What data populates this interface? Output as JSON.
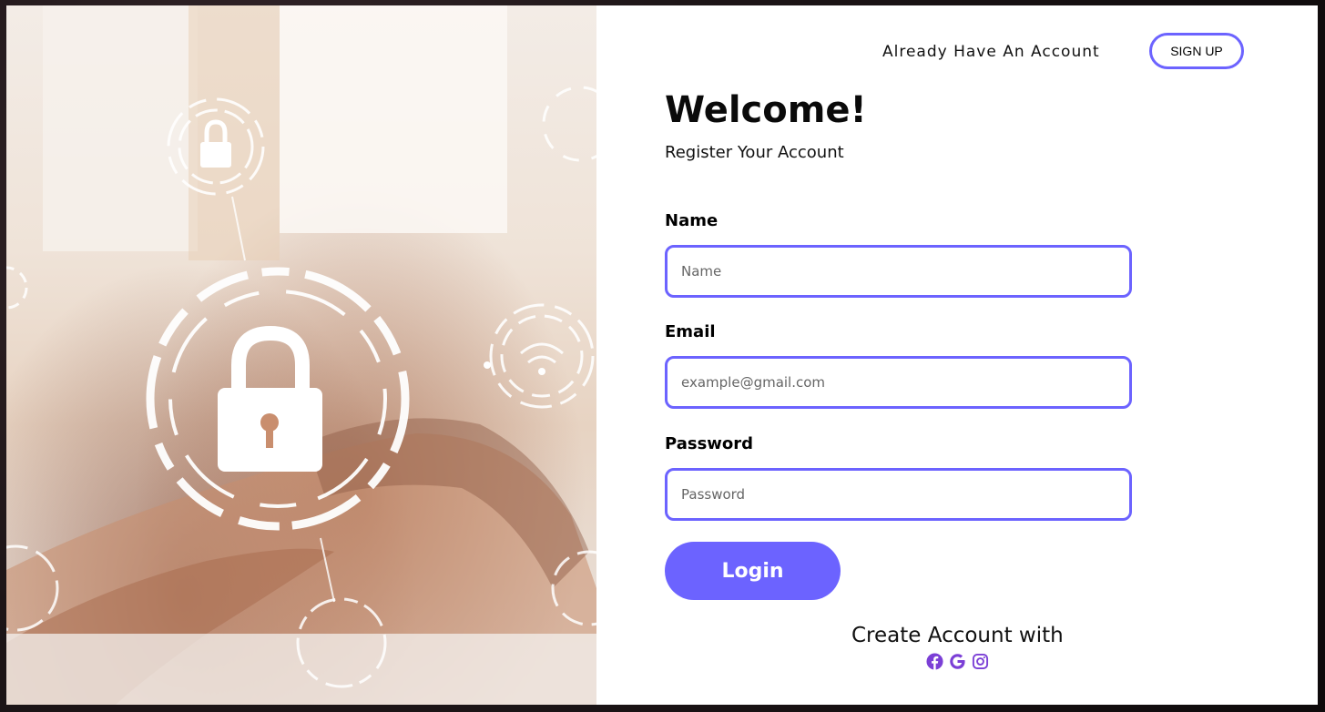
{
  "header": {
    "already_text": "Already Have An Account",
    "signup_label": "SIGN UP"
  },
  "form": {
    "title": "Welcome!",
    "subtitle": "Register Your Account",
    "name": {
      "label": "Name",
      "placeholder": "Name",
      "value": ""
    },
    "email": {
      "label": "Email",
      "placeholder": "example@gmail.com",
      "value": ""
    },
    "password": {
      "label": "Password",
      "placeholder": "Password",
      "value": ""
    },
    "login_label": "Login"
  },
  "social": {
    "heading": "Create Account with",
    "icons": [
      "facebook-icon",
      "google-icon",
      "instagram-icon"
    ]
  },
  "colors": {
    "accent": "#6c63ff",
    "social_icon": "#7b3fd6"
  }
}
